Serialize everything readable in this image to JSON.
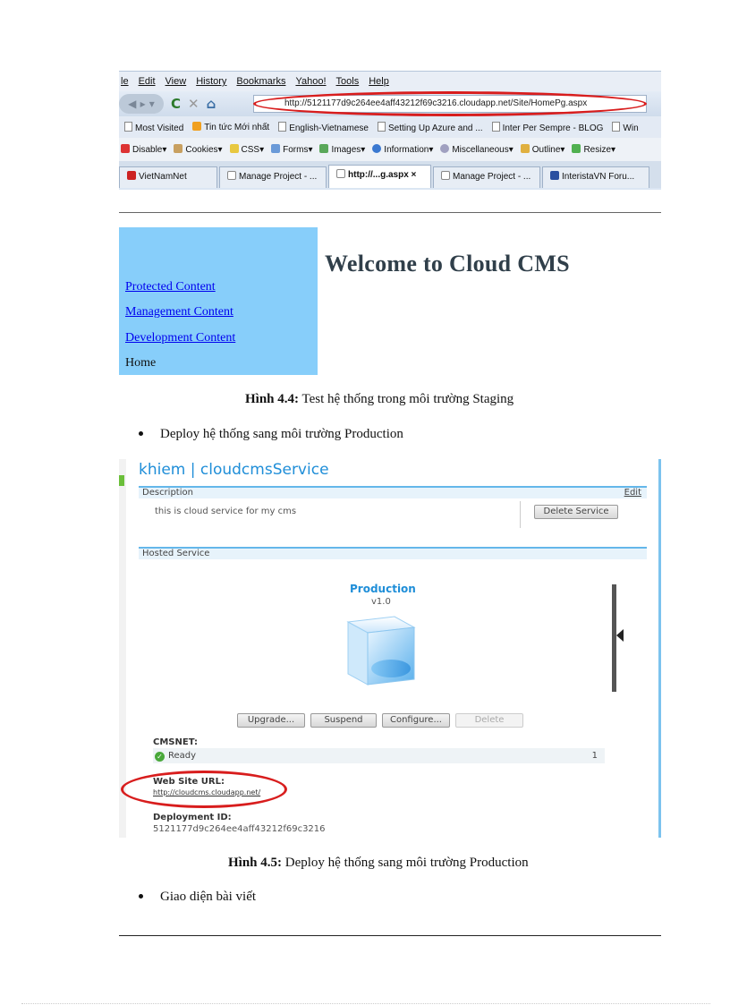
{
  "browser": {
    "menu": [
      "le",
      "Edit",
      "View",
      "History",
      "Bookmarks",
      "Yahoo!",
      "Tools",
      "Help"
    ],
    "url": "http://5121177d9c264ee4aff43212f69c3216.cloudapp.net/Site/HomePg.aspx",
    "bookmarks": [
      "Most Visited",
      "Tin tức Mới nhất",
      "English-Vietnamese",
      "Setting Up Azure and ...",
      "Inter Per Sempre - BLOG",
      "Win"
    ],
    "toolbar": [
      "Disable▾",
      "Cookies▾",
      "CSS▾",
      "Forms▾",
      "Images▾",
      "Information▾",
      "Miscellaneous▾",
      "Outline▾",
      "Resize▾"
    ],
    "tabs": [
      "VietNamNet",
      "Manage Project - ...",
      "http://...g.aspx ×",
      "Manage Project - ...",
      "InteristaVN Foru..."
    ]
  },
  "cms": {
    "title": "Welcome to Cloud CMS",
    "links": [
      "Protected Content",
      "Management Content",
      "Development Content"
    ],
    "home": "Home"
  },
  "captions": {
    "fig44_label": "Hình 4.4:",
    "fig44_text": " Test hệ thống trong môi trường Staging",
    "fig45_label": "Hình 4.5:",
    "fig45_text": " Deploy hệ thống sang môi trường Production"
  },
  "bullets": {
    "deploy": "Deploy hệ thống sang môi trường Production",
    "ui": "Giao diện bài viết"
  },
  "azure": {
    "title": "khiem | cloudcmsService",
    "description_header": "Description",
    "edit": "Edit",
    "description": "this is cloud service for my cms",
    "delete_service": "Delete Service",
    "hosted_header": "Hosted Service",
    "env": "Production",
    "version": "v1.0",
    "buttons": [
      "Upgrade...",
      "Suspend",
      "Configure...",
      "Delete"
    ],
    "role_name": "CMSNET:",
    "status": "Ready",
    "count": "1",
    "url_label": "Web Site URL:",
    "url": "http://cloudcms.cloudapp.net/",
    "deploy_label": "Deployment ID:",
    "deploy_id": "5121177d9c264ee4aff43212f69c3216"
  }
}
